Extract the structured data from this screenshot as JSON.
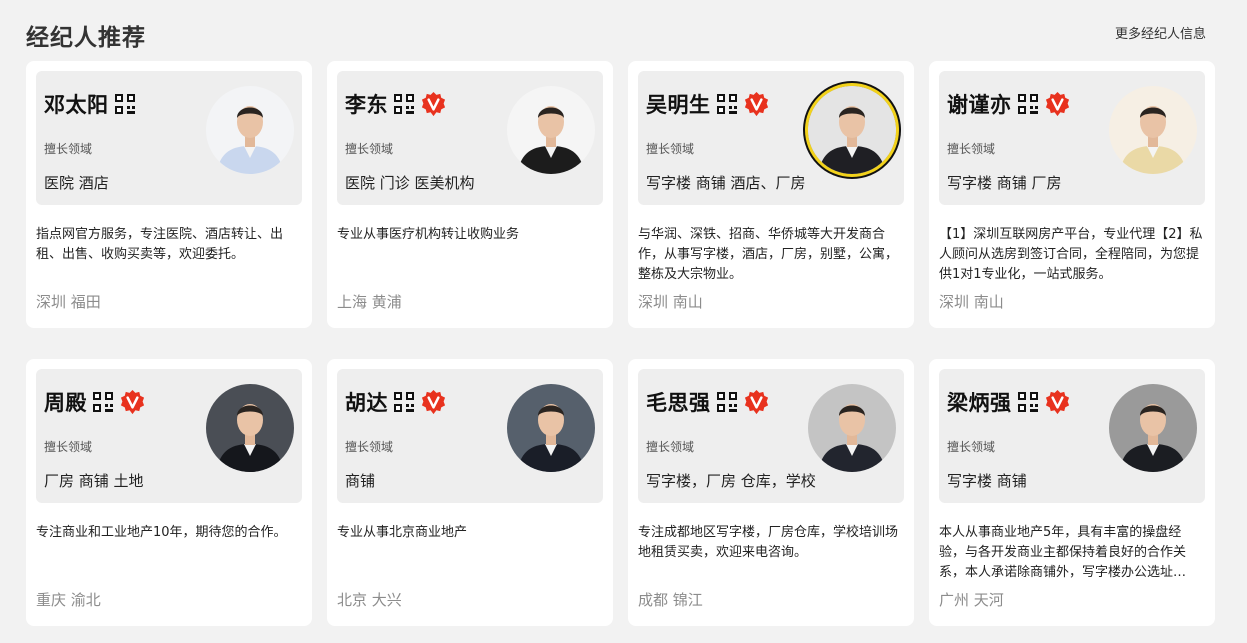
{
  "header": {
    "title": "经纪人推荐",
    "more_link": "更多经纪人信息"
  },
  "field_label": "擅长领域",
  "agents": [
    {
      "name": "邓太阳",
      "verified": false,
      "fields": "医院 酒店",
      "description": "指点网官方服务，专注医院、酒店转让、出租、出售、收购买卖等，欢迎委托。",
      "location": "深圳 福田",
      "avatar_bg": "#f3f4f6",
      "shirt_color": "#c9d7ee"
    },
    {
      "name": "李东",
      "verified": true,
      "fields": "医院 门诊 医美机构",
      "description": "专业从事医疗机构转让收购业务",
      "location": "上海 黄浦",
      "avatar_bg": "#f5f5f5",
      "shirt_color": "#1c1c1c"
    },
    {
      "name": "吴明生",
      "verified": true,
      "fields": "写字楼 商铺 酒店、厂房",
      "description": "与华润、深铁、招商、华侨城等大开发商合作，从事写字楼，酒店，厂房，别墅，公寓，整栋及大宗物业。",
      "location": "深圳 南山",
      "avatar_bg": "#e4e4e4",
      "shirt_color": "#1f1f24"
    },
    {
      "name": "谢谨亦",
      "verified": true,
      "fields": "写字楼 商铺 厂房",
      "description": "【1】深圳互联网房产平台，专业代理【2】私人顾问从选房到签订合同，全程陪同，为您提供1对1专业化，一站式服务。",
      "location": "深圳 南山",
      "avatar_bg": "#f6efe4",
      "shirt_color": "#ead9a6"
    },
    {
      "name": "周殿",
      "verified": true,
      "fields": "厂房 商铺 土地",
      "description": "专注商业和工业地产10年，期待您的合作。",
      "location": "重庆 渝北",
      "avatar_bg": "#4a4e55",
      "shirt_color": "#15171c"
    },
    {
      "name": "胡达",
      "verified": true,
      "fields": "商铺",
      "description": "专业从事北京商业地产",
      "location": "北京 大兴",
      "avatar_bg": "#56606c",
      "shirt_color": "#1a1e28"
    },
    {
      "name": "毛思强",
      "verified": true,
      "fields": "写字楼，厂房 仓库，学校",
      "description": "专注成都地区写字楼，厂房仓库，学校培训场地租赁买卖，欢迎来电咨询。",
      "location": "成都 锦江",
      "avatar_bg": "#c4c4c4",
      "shirt_color": "#22252e"
    },
    {
      "name": "梁炳强",
      "verified": true,
      "fields": "写字楼 商铺",
      "description": "本人从事商业地产5年，具有丰富的操盘经验，与各开发商业主都保持着良好的合作关系，本人承诺除商铺外，写字楼办公选址…",
      "location": "广州 天河",
      "avatar_bg": "#9a9a9a",
      "shirt_color": "#1b1d22"
    }
  ]
}
